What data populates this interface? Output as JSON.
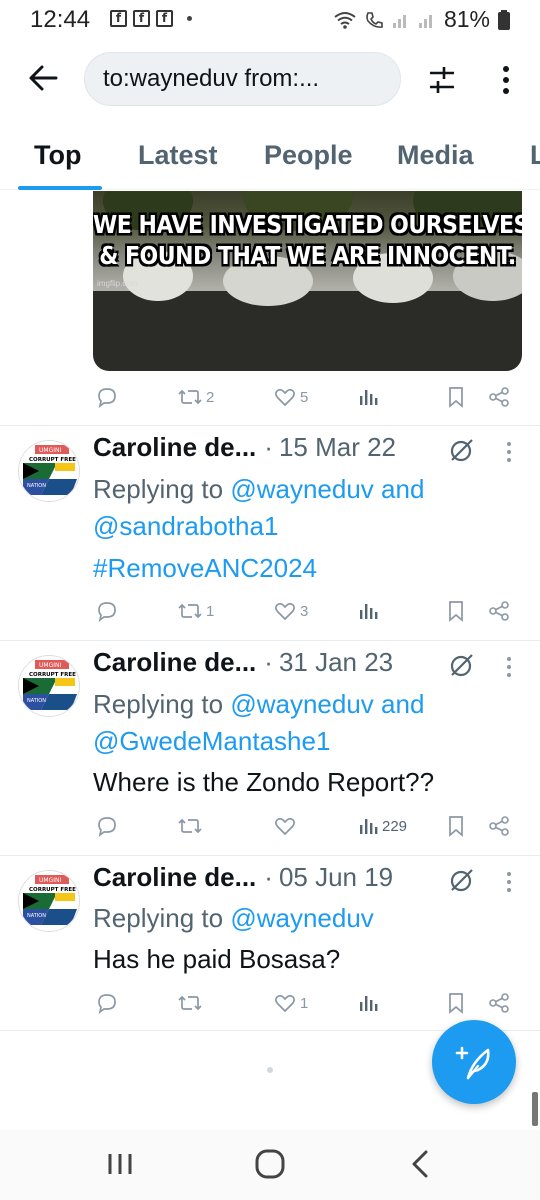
{
  "status_bar": {
    "time": "12:44",
    "battery": "81%",
    "notification_icons": [
      "facebook-icon",
      "facebook-icon",
      "facebook-icon"
    ]
  },
  "header": {
    "search_query": "to:wayneduv from:...",
    "back_icon": "back-arrow-icon",
    "filter_icon": "filter-sliders-icon",
    "more_icon": "more-vertical-icon"
  },
  "tabs": [
    {
      "label": "Top",
      "active": true
    },
    {
      "label": "Latest",
      "active": false
    },
    {
      "label": "People",
      "active": false
    },
    {
      "label": "Media",
      "active": false
    },
    {
      "label": "L",
      "active": false
    }
  ],
  "media": {
    "caption_line1": "WE HAVE INVESTIGATED OURSELVES",
    "caption_line2": "& FOUND THAT WE ARE INNOCENT.",
    "watermark": "imgflip.com"
  },
  "first_actions": {
    "retweets": "2",
    "likes": "5",
    "views": ""
  },
  "tweets": [
    {
      "author": "Caroline de...",
      "separator": "·",
      "date": "15 Mar 22",
      "reply_prefix": "Replying to",
      "reply_to_1": "@wayneduv",
      "reply_and": "and",
      "reply_to_2": "@sandrabotha1",
      "body": "#RemoveANC2024",
      "retweets": "1",
      "likes": "3",
      "views": ""
    },
    {
      "author": "Caroline de...",
      "separator": "·",
      "date": "31 Jan 23",
      "reply_prefix": "Replying to",
      "reply_to_1": "@wayneduv",
      "reply_and": "and",
      "reply_to_2": "@GwedeMantashe1",
      "body": "Where is the Zondo Report??",
      "retweets": "",
      "likes": "",
      "views": "229"
    },
    {
      "author": "Caroline de...",
      "separator": "·",
      "date": "05 Jun 19",
      "reply_prefix": "Replying to",
      "reply_to_1": "@wayneduv",
      "body": "Has he paid Bosasa?",
      "retweets": "",
      "likes": "1",
      "views": ""
    }
  ],
  "avatar": {
    "text_top": "UMGINI",
    "text_mid": "CORRUPT FREE",
    "text_nation": "NATION"
  },
  "colors": {
    "accent": "#1d9bf0",
    "text": "#0f1419",
    "muted": "#536471"
  }
}
